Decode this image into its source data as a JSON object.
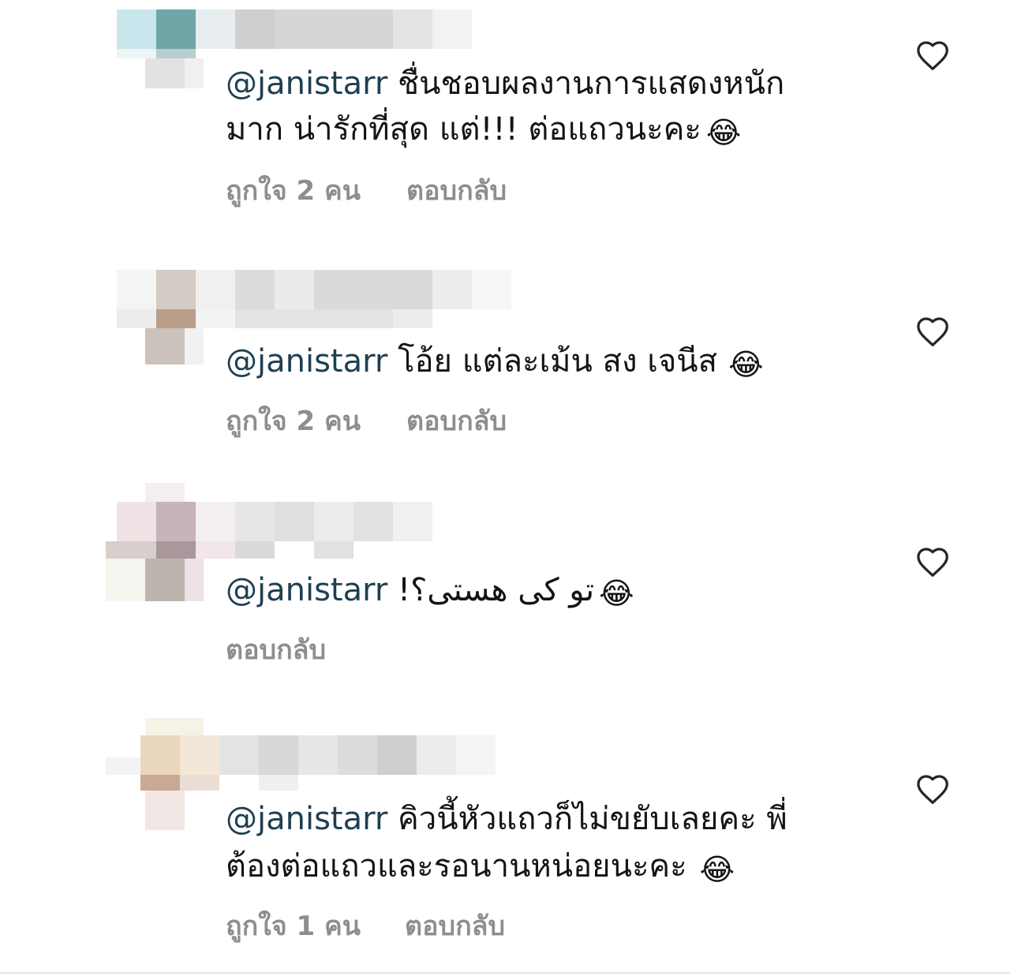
{
  "comments": [
    {
      "mention": "@janistarr",
      "text_line1": " ชื่นชอบผลงานการแสดงหนัก",
      "text_line2": "มาก น่ารักที่สุด แต่!!! ต่อแถวนะคะ",
      "emoji": "😂",
      "likes": "ถูกใจ 2 คน",
      "reply": "ตอบกลับ",
      "heart_icon": "heart-outline-icon"
    },
    {
      "mention": "@janistarr",
      "text_line1": " โอ้ย แต่ละเม้น สง เจนีส",
      "emoji": "😂",
      "likes": "ถูกใจ 2 คน",
      "reply": "ตอบกลับ",
      "heart_icon": "heart-outline-icon"
    },
    {
      "mention": "@janistarr",
      "text_line1": " !تو کی هستی؟",
      "emoji": "😂",
      "reply": "ตอบกลับ",
      "heart_icon": "heart-outline-icon"
    },
    {
      "mention": "@janistarr",
      "text_line1": " คิวนี้หัวแถวก็ไม่ขยับเลยคะ พี่",
      "text_line2": "ต้องต่อแถวและรอนานหน่อยนะคะ",
      "emoji": "😂",
      "likes": "ถูกใจ 1 คน",
      "reply": "ตอบกลับ",
      "heart_icon": "heart-outline-icon"
    }
  ],
  "colors": {
    "text": "#141414",
    "mention": "#1f3f52",
    "meta": "#8e8e8e",
    "heart_stroke": "#262626"
  }
}
